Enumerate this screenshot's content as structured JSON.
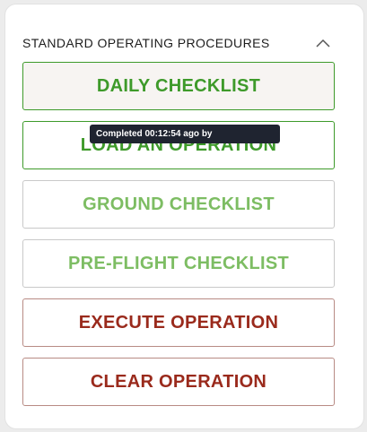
{
  "panel": {
    "title": "STANDARD OPERATING PROCEDURES",
    "collapse_icon": "chevron-up-icon"
  },
  "buttons": [
    {
      "label": "DAILY CHECKLIST",
      "status": "completed",
      "color": "#3e9a2a"
    },
    {
      "label": "LOAD AN OPERATION",
      "status": "completed",
      "color": "#3e9a2a"
    },
    {
      "label": "GROUND CHECKLIST",
      "status": "pending",
      "color": "#7dbd63"
    },
    {
      "label": "PRE-FLIGHT CHECKLIST",
      "status": "pending",
      "color": "#7dbd63"
    },
    {
      "label": "EXECUTE OPERATION",
      "status": "action",
      "color": "#9a2a1c"
    },
    {
      "label": "CLEAR OPERATION",
      "status": "action",
      "color": "#9a2a1c"
    }
  ],
  "tooltip": {
    "text": "Completed 00:12:54 ago by"
  }
}
